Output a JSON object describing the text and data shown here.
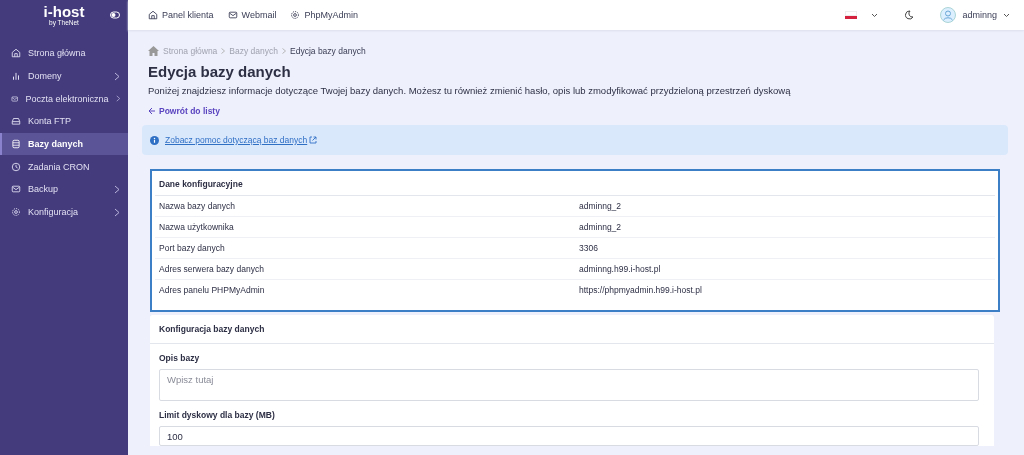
{
  "sidebar": {
    "logo": {
      "name": "i-host",
      "tagline": "by TheNet"
    },
    "items": [
      {
        "label": "Strona główna",
        "submenu": false,
        "selected": false
      },
      {
        "label": "Domeny",
        "submenu": true,
        "selected": false
      },
      {
        "label": "Poczta elektroniczna",
        "submenu": true,
        "selected": false
      },
      {
        "label": "Konta FTP",
        "submenu": false,
        "selected": false
      },
      {
        "label": "Bazy danych",
        "submenu": false,
        "selected": true
      },
      {
        "label": "Zadania CRON",
        "submenu": false,
        "selected": false
      },
      {
        "label": "Backup",
        "submenu": true,
        "selected": false
      },
      {
        "label": "Konfiguracja",
        "submenu": true,
        "selected": false
      }
    ]
  },
  "topbar": {
    "links": [
      {
        "label": "Panel klienta"
      },
      {
        "label": "Webmail"
      },
      {
        "label": "PhpMyAdmin"
      }
    ],
    "user": "adminng"
  },
  "breadcrumb": [
    {
      "label": "Strona główna",
      "current": false
    },
    {
      "label": "Bazy danych",
      "current": false
    },
    {
      "label": "Edycja bazy danych",
      "current": true
    }
  ],
  "title": "Edycja bazy danych",
  "description": "Poniżej znajdziesz informacje dotyczące Twojej bazy danych. Możesz tu również zmienić hasło, opis lub zmodyfikować przydzieloną przestrzeń dyskową",
  "back_link": "Powrót do listy",
  "info_link": "Zobacz pomoc dotyczącą baz danych",
  "config_table": {
    "title": "Dane konfiguracyjne",
    "rows": [
      {
        "label": "Nazwa bazy danych",
        "value": "adminng_2"
      },
      {
        "label": "Nazwa użytkownika",
        "value": "adminng_2"
      },
      {
        "label": "Port bazy danych",
        "value": "3306"
      },
      {
        "label": "Adres serwera bazy danych",
        "value": "adminng.h99.i-host.pl"
      },
      {
        "label": "Adres panelu PHPMyAdmin",
        "value": "https://phpmyadmin.h99.i-host.pl"
      }
    ]
  },
  "form": {
    "title": "Konfiguracja bazy danych",
    "fields": [
      {
        "label": "Opis bazy",
        "kind": "textarea",
        "placeholder": "Wpisz tutaj"
      },
      {
        "label": "Limit dyskowy dla bazy (MB)",
        "kind": "input",
        "value": "100"
      }
    ]
  }
}
